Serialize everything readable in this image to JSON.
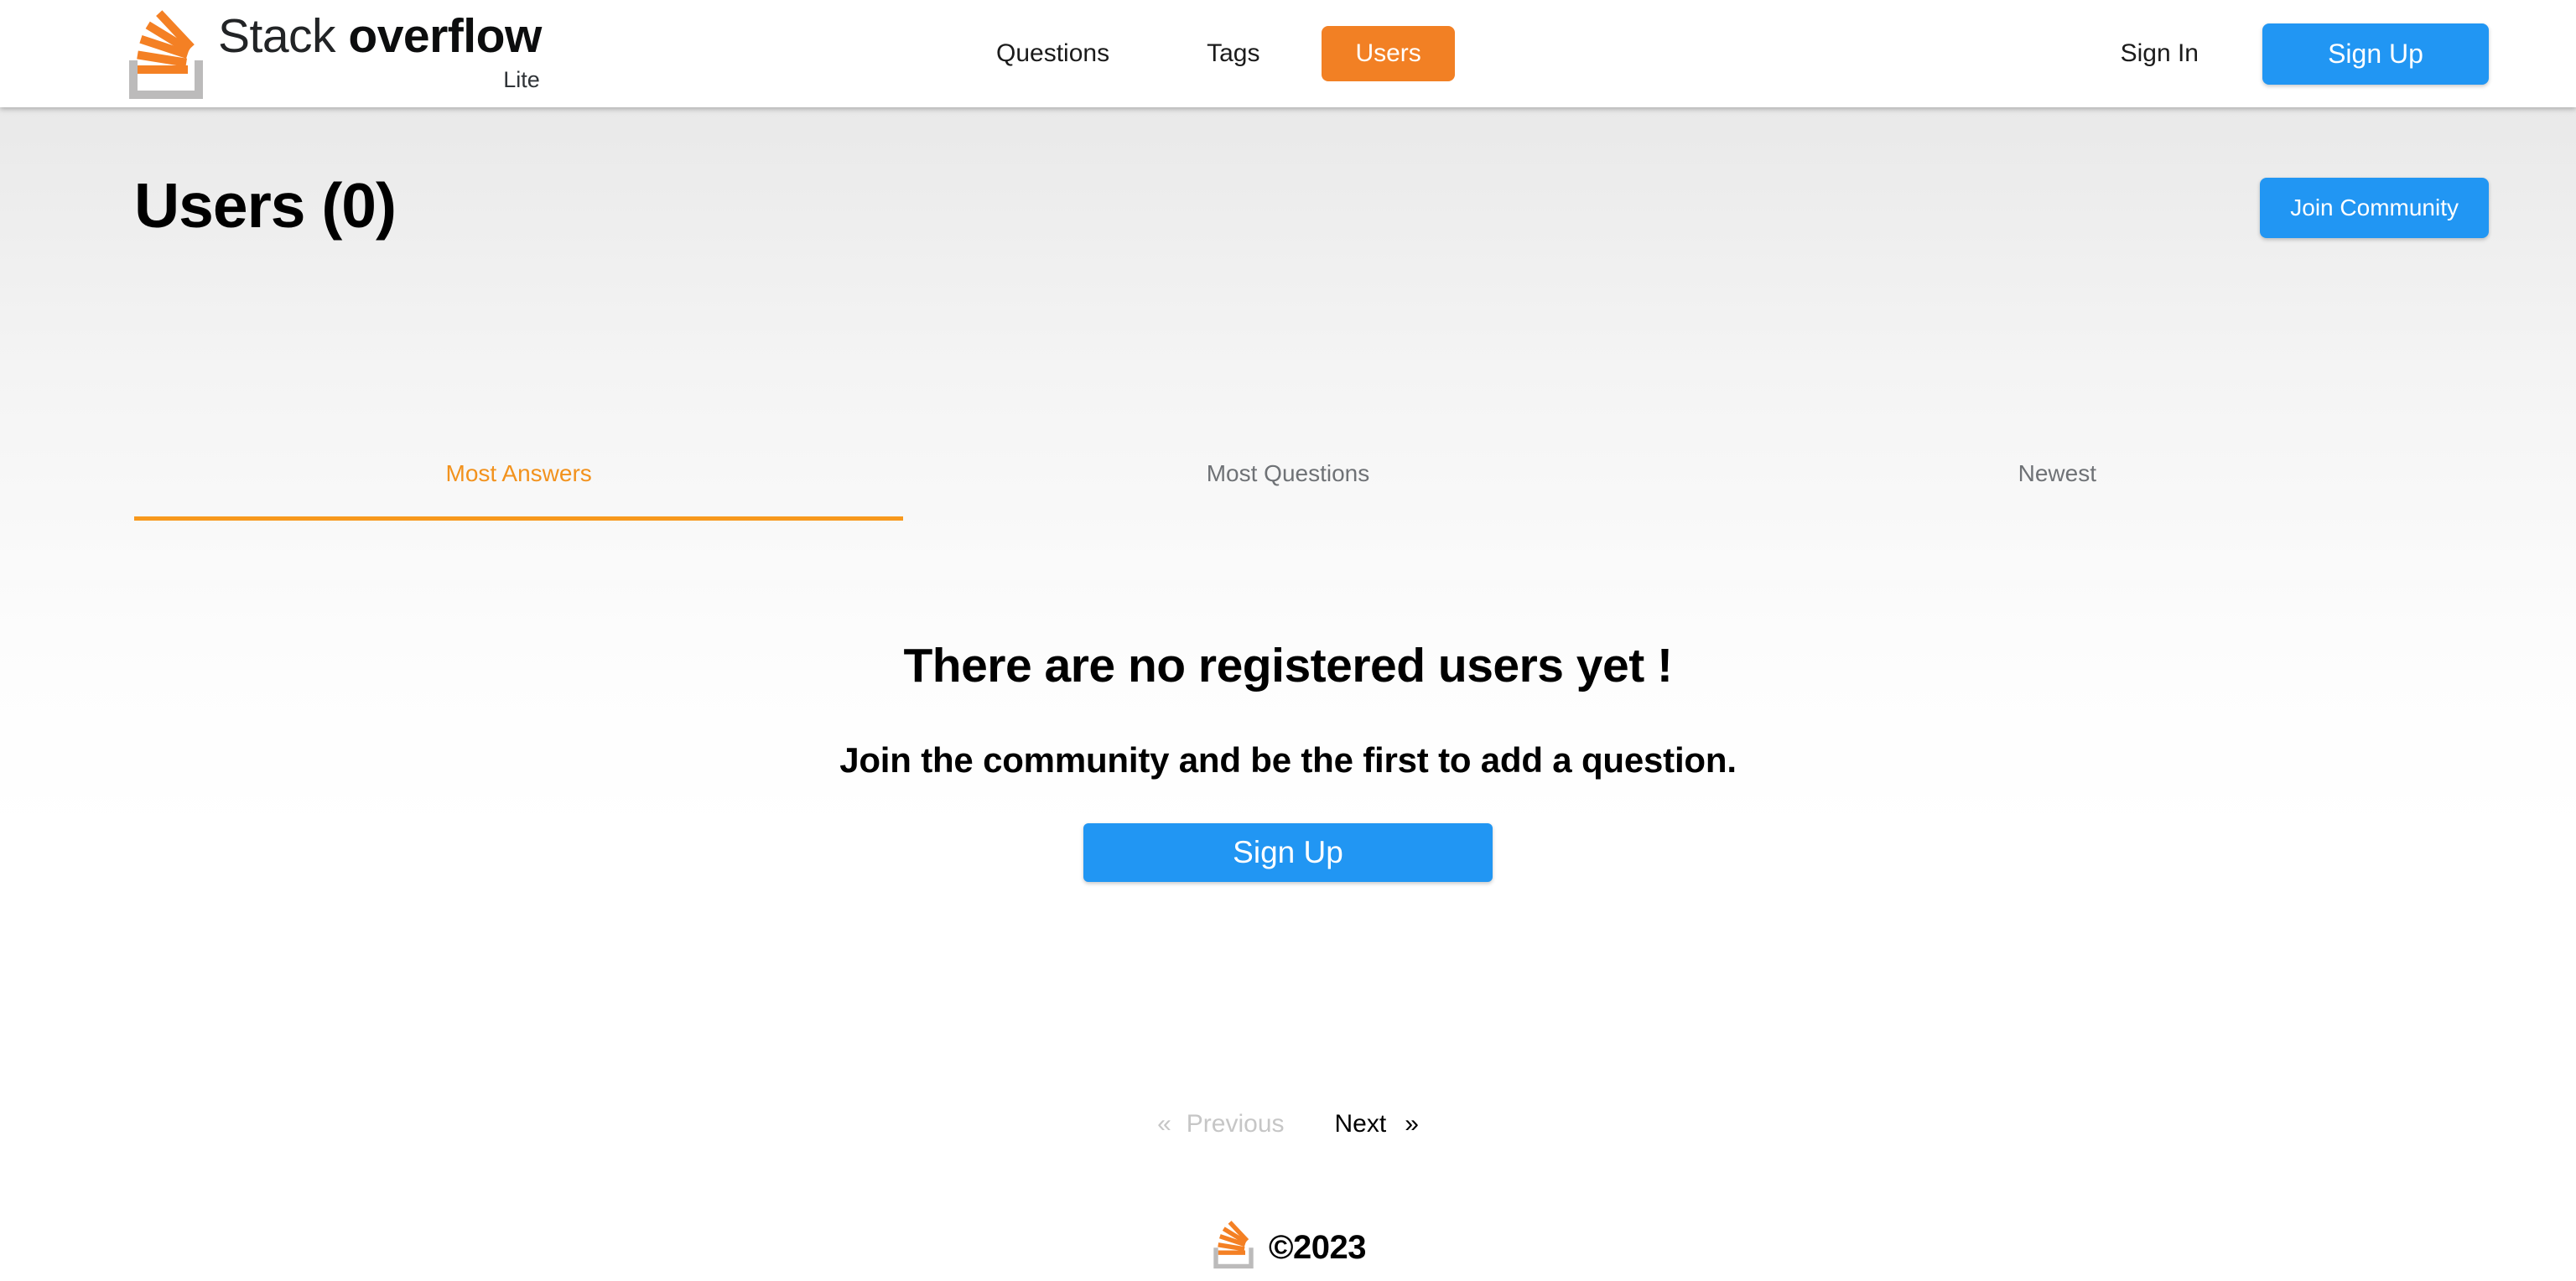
{
  "header": {
    "brand": {
      "word_light": "Stack ",
      "word_bold": "overflow",
      "subtitle": "Lite",
      "logo_icon": "stack-overflow-logo-icon"
    },
    "nav": [
      {
        "label": "Questions",
        "active": false
      },
      {
        "label": "Tags",
        "active": false
      },
      {
        "label": "Users",
        "active": true
      }
    ],
    "sign_in_label": "Sign In",
    "sign_up_label": "Sign Up"
  },
  "main": {
    "page_title": "Users (0)",
    "join_community_label": "Join Community",
    "tabs": [
      {
        "label": "Most Answers",
        "active": true
      },
      {
        "label": "Most Questions",
        "active": false
      },
      {
        "label": "Newest",
        "active": false
      }
    ],
    "empty_state": {
      "heading": "There are no registered users yet !",
      "subheading": "Join the community and be the first to add a question.",
      "cta_label": "Sign Up"
    },
    "pagination": {
      "prev_chevron": "«",
      "prev_label": "Previous",
      "next_label": "Next",
      "next_chevron": "»"
    }
  },
  "footer": {
    "copyright": "©2023",
    "logo_icon": "stack-overflow-logo-icon"
  },
  "colors": {
    "brand_orange": "#F28024",
    "tab_active_orange": "#F8991D",
    "accent_blue": "#2196F3",
    "logo_gray": "#BCBBBB",
    "muted_text": "#6F7276",
    "disabled_text": "#C6C6C6"
  }
}
